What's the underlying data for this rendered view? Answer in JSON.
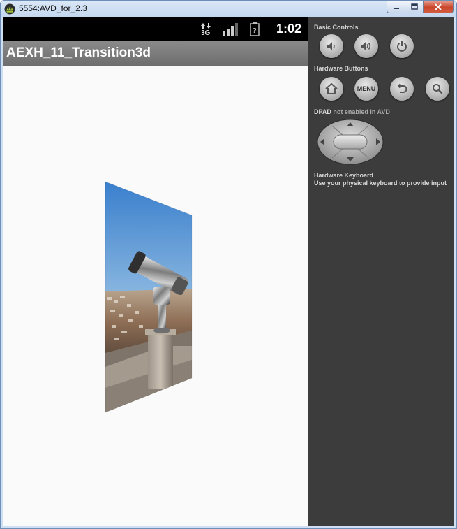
{
  "window": {
    "title": "5554:AVD_for_2.3"
  },
  "status_bar": {
    "network_label": "3G",
    "time": "1:02"
  },
  "app": {
    "title": "AEXH_11_Transition3d"
  },
  "controls_panel": {
    "basic_controls_label": "Basic Controls",
    "hardware_buttons_label": "Hardware Buttons",
    "menu_button_label": "MENU",
    "dpad_label": "DPAD",
    "dpad_note": "not enabled in AVD",
    "keyboard_label": "Hardware Keyboard",
    "keyboard_desc": "Use your physical keyboard to provide input"
  },
  "colors": {
    "sky_top": "#3a83cf",
    "sky_bottom": "#cfe0ee",
    "panel_bg": "#3c3c3c"
  }
}
